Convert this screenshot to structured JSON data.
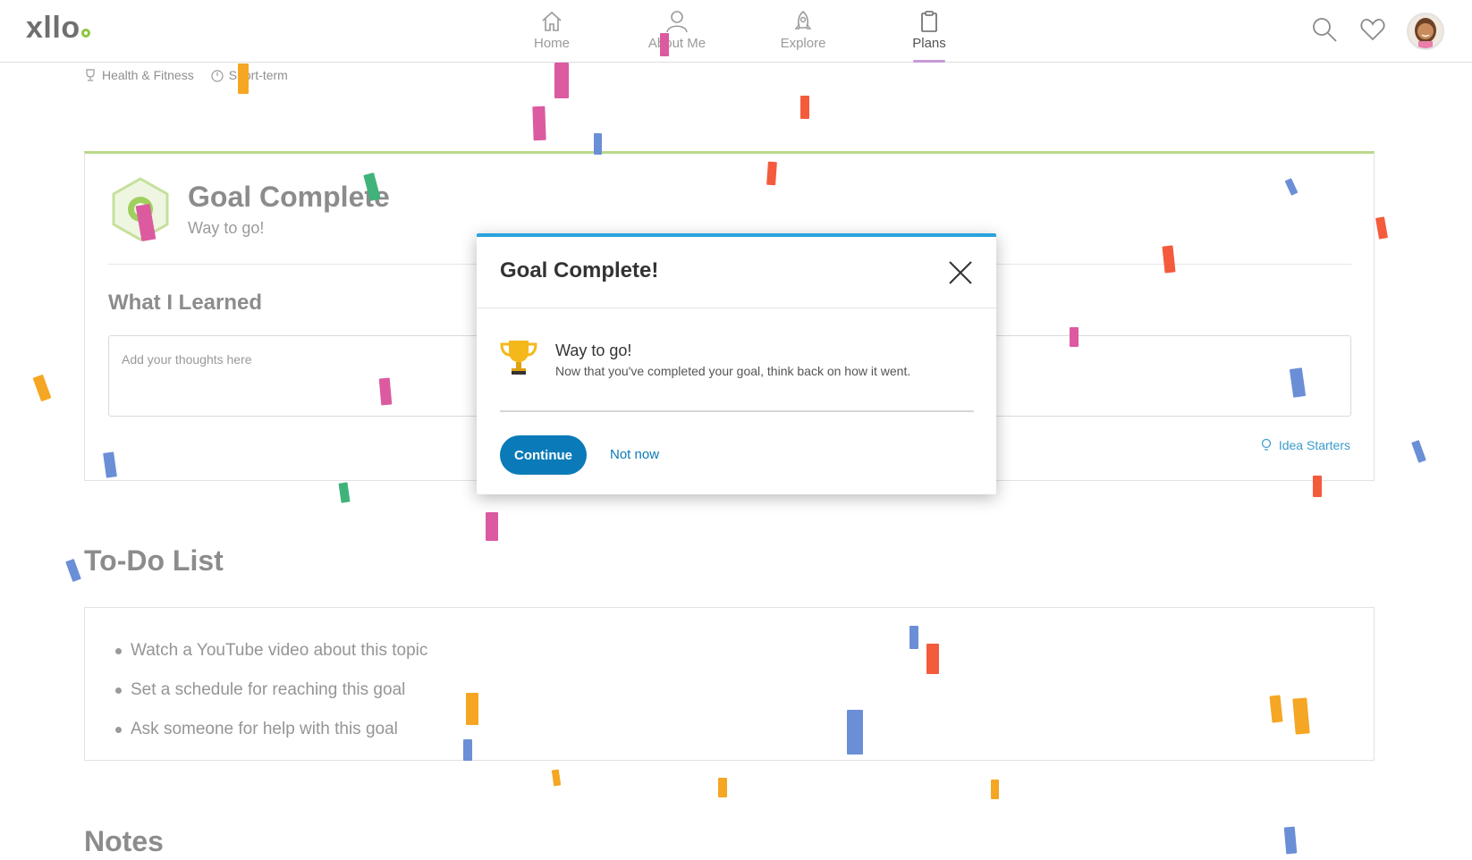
{
  "nav": {
    "logo": "x",
    "logo_rest": "llo",
    "items": [
      {
        "label": "Home",
        "icon": "home-icon"
      },
      {
        "label": "About Me",
        "icon": "person-icon"
      },
      {
        "label": "Explore",
        "icon": "rocket-icon"
      },
      {
        "label": "Plans",
        "icon": "clipboard-icon",
        "active": true
      }
    ]
  },
  "tags": {
    "category": "Health & Fitness",
    "term": "Short-term"
  },
  "goal": {
    "title": "Goal Complete",
    "subtitle": "Way to go!",
    "learned_title": "What I Learned",
    "thoughts_placeholder": "Add your thoughts here",
    "idea_starters": "Idea Starters"
  },
  "todo": {
    "title": "To-Do List",
    "items": [
      "Watch a YouTube video about this topic",
      "Set a schedule for reaching this goal",
      "Ask someone for help with this goal"
    ]
  },
  "notes": {
    "title": "Notes"
  },
  "modal": {
    "title": "Goal Complete!",
    "heading": "Way to go!",
    "message": "Now that you've completed your goal, think back on how it went.",
    "continue_label": "Continue",
    "not_now_label": "Not now"
  },
  "colors": {
    "accent_blue": "#2aa3dc",
    "button_blue": "#0a7ab8",
    "plans_underline": "#c69ad9",
    "goal_green": "#b8d98a"
  }
}
